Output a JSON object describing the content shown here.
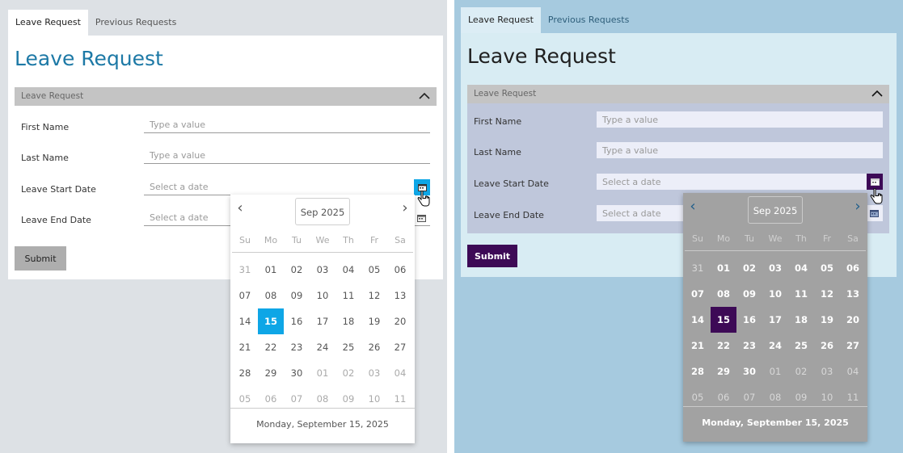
{
  "colors": {
    "panel_a_background": "#dde1e5",
    "panel_a_title": "#1d79a6",
    "panel_a_selected_day": "#0ea6e6",
    "panel_b_background": "#a6cadf",
    "panel_b_card": "#d8ecf3",
    "panel_b_accent": "#3d0a56",
    "panel_b_picker": "#a2a2a2"
  },
  "icons": [
    "chevron-up-icon",
    "calendar-icon",
    "hand-cursor-icon",
    "chevron-left-icon",
    "chevron-right-icon"
  ],
  "panel_a": {
    "tabs": [
      {
        "label": "Leave Request",
        "active": true
      },
      {
        "label": "Previous Requests",
        "active": false
      }
    ],
    "page_title": "Leave Request",
    "section_title": "Leave Request",
    "fields": {
      "first_name": {
        "label": "First Name",
        "placeholder": "Type a value",
        "value": ""
      },
      "last_name": {
        "label": "Last Name",
        "placeholder": "Type a value",
        "value": ""
      },
      "start_date": {
        "label": "Leave Start Date",
        "placeholder": "Select a date",
        "value": ""
      },
      "end_date": {
        "label": "Leave End Date",
        "placeholder": "Select a date",
        "value": ""
      }
    },
    "submit_label": "Submit",
    "picker": {
      "prev": "‹",
      "next": "›",
      "month_label": "Sep 2025",
      "weekdays": [
        "Su",
        "Mo",
        "Tu",
        "We",
        "Th",
        "Fr",
        "Sa"
      ],
      "weeks": [
        [
          "31",
          "01",
          "02",
          "03",
          "04",
          "05",
          "06"
        ],
        [
          "07",
          "08",
          "09",
          "10",
          "11",
          "12",
          "13"
        ],
        [
          "14",
          "15",
          "16",
          "17",
          "18",
          "19",
          "20"
        ],
        [
          "21",
          "22",
          "23",
          "24",
          "25",
          "26",
          "27"
        ],
        [
          "28",
          "29",
          "30",
          "01",
          "02",
          "03",
          "04"
        ],
        [
          "05",
          "06",
          "07",
          "08",
          "09",
          "10",
          "11"
        ]
      ],
      "selected_day": "15",
      "footer": "Monday, September 15, 2025"
    }
  },
  "panel_b": {
    "tabs": [
      {
        "label": "Leave Request",
        "active": true
      },
      {
        "label": "Previous Requests",
        "active": false
      }
    ],
    "page_title": "Leave Request",
    "section_title": "Leave Request",
    "fields": {
      "first_name": {
        "label": "First Name",
        "placeholder": "Type a value",
        "value": ""
      },
      "last_name": {
        "label": "Last Name",
        "placeholder": "Type a value",
        "value": ""
      },
      "start_date": {
        "label": "Leave Start Date",
        "placeholder": "Select a date",
        "value": ""
      },
      "end_date": {
        "label": "Leave End Date",
        "placeholder": "Select a date",
        "value": ""
      }
    },
    "submit_label": "Submit",
    "picker": {
      "prev": "‹",
      "next": "›",
      "month_label": "Sep 2025",
      "weekdays": [
        "Su",
        "Mo",
        "Tu",
        "We",
        "Th",
        "Fr",
        "Sa"
      ],
      "weeks": [
        [
          "31",
          "01",
          "02",
          "03",
          "04",
          "05",
          "06"
        ],
        [
          "07",
          "08",
          "09",
          "10",
          "11",
          "12",
          "13"
        ],
        [
          "14",
          "15",
          "16",
          "17",
          "18",
          "19",
          "20"
        ],
        [
          "21",
          "22",
          "23",
          "24",
          "25",
          "26",
          "27"
        ],
        [
          "28",
          "29",
          "30",
          "01",
          "02",
          "03",
          "04"
        ],
        [
          "05",
          "06",
          "07",
          "08",
          "09",
          "10",
          "11"
        ]
      ],
      "selected_day": "15",
      "footer": "Monday, September 15, 2025"
    }
  }
}
